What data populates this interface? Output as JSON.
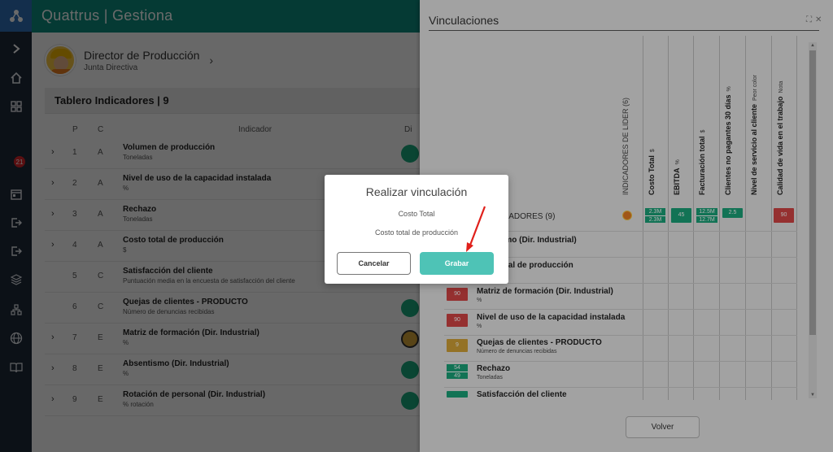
{
  "app": {
    "title": "Quattrus | Gestiona"
  },
  "rail": {
    "icons": [
      "logo-icon",
      "chevron-right-icon",
      "home-icon",
      "dashboard-icon",
      "notification-icon",
      "calendar-icon",
      "exit-icon",
      "logout-icon",
      "layers-icon",
      "org-chart-icon",
      "globe-icon",
      "book-icon"
    ],
    "badge": "21"
  },
  "profile": {
    "name": "Director de Producción",
    "role": "Junta Directiva",
    "chevron": "›"
  },
  "board": {
    "title": "Tablero Indicadores | 9",
    "columns": {
      "p": "P",
      "c": "C",
      "indicador": "Indicador",
      "di": "Di"
    },
    "rows": [
      {
        "p": "1",
        "c": "A",
        "name": "Volumen de producción",
        "unit": "Toneladas",
        "chev": "›",
        "status": "green"
      },
      {
        "p": "2",
        "c": "A",
        "name": "Nivel de uso de la capacidad instalada",
        "unit": "%",
        "chev": "›",
        "status": "green"
      },
      {
        "p": "3",
        "c": "A",
        "name": "Rechazo",
        "unit": "Toneladas",
        "chev": "›",
        "status": "green"
      },
      {
        "p": "4",
        "c": "A",
        "name": "Costo total de producción",
        "unit": "$",
        "chev": "›",
        "status": "green"
      },
      {
        "p": "5",
        "c": "C",
        "name": "Satisfacción del cliente",
        "unit": "Puntuación media en la encuesta de satisfacción del cliente",
        "chev": "",
        "status": "none"
      },
      {
        "p": "6",
        "c": "C",
        "name": "Quejas de clientes - PRODUCTO",
        "unit": "Número de denuncias recibidas",
        "chev": "",
        "status": "green"
      },
      {
        "p": "7",
        "c": "E",
        "name": "Matriz de formación (Dir. Industrial)",
        "unit": "%",
        "chev": "›",
        "status": "yellow"
      },
      {
        "p": "8",
        "c": "E",
        "name": "Absentismo (Dir. Industrial)",
        "unit": "%",
        "chev": "›",
        "status": "green"
      },
      {
        "p": "9",
        "c": "E",
        "name": "Rotación de personal (Dir. Industrial)",
        "unit": "% rotación",
        "chev": "›",
        "status": "green"
      }
    ]
  },
  "panel": {
    "title": "Vinculaciones",
    "window_icons": [
      "⛶",
      "✕"
    ],
    "leader_col": "INDICADORES DE LIDER (6)",
    "columns": [
      {
        "name": "Costo Total",
        "unit": "$"
      },
      {
        "name": "EBITDA",
        "unit": "%"
      },
      {
        "name": "Facturación total",
        "unit": "$"
      },
      {
        "name": "Clientes no pagantes 30 días",
        "unit": "%"
      },
      {
        "name": "Nivel de servicio al cliente",
        "unit": "Peor color"
      },
      {
        "name": "Calidad de vida en el trabajo",
        "unit": "Nota"
      }
    ],
    "leader_row_label": "CADORES (9)",
    "leader_values": {
      "costo": {
        "top": "2.3M",
        "bot": "2.3M"
      },
      "ebitda": "45",
      "facturacion": {
        "top": "12.5M",
        "bot": "12.7M"
      },
      "clientes": "2.5",
      "calidad": "90"
    },
    "rows": [
      {
        "name": "ismo (Dir. Industrial)",
        "unit": ""
      },
      {
        "name": "total de producción",
        "unit": ""
      },
      {
        "name": "Matriz de formación (Dir. Industrial)",
        "unit": "%",
        "chip": "90",
        "chip_color": "red"
      },
      {
        "name": "Nivel de uso de la capacidad instalada",
        "unit": "%",
        "chip": "90",
        "chip_color": "red"
      },
      {
        "name": "Quejas de clientes - PRODUCTO",
        "unit": "Número de denuncias recibidas",
        "chip": "9",
        "chip_color": "yellow"
      },
      {
        "name": "Rechazo",
        "unit": "Toneladas",
        "frac_top": "54",
        "frac_bot": "49",
        "chip_color": "green"
      },
      {
        "name": "Satisfacción del cliente",
        "unit": "",
        "chip": "",
        "chip_color": "green"
      }
    ],
    "volver": "Volver"
  },
  "modal": {
    "title": "Realizar vinculación",
    "line1": "Costo Total",
    "line2": "Costo total de producción",
    "cancel": "Cancelar",
    "save": "Grabar"
  },
  "colors": {
    "teal": "#0e8a7e",
    "rail": "#1e2a3a",
    "green": "#1aa57a",
    "red": "#d64545",
    "yellow": "#d4a437",
    "save": "#4ec3b6",
    "arrow": "#e0201b"
  }
}
